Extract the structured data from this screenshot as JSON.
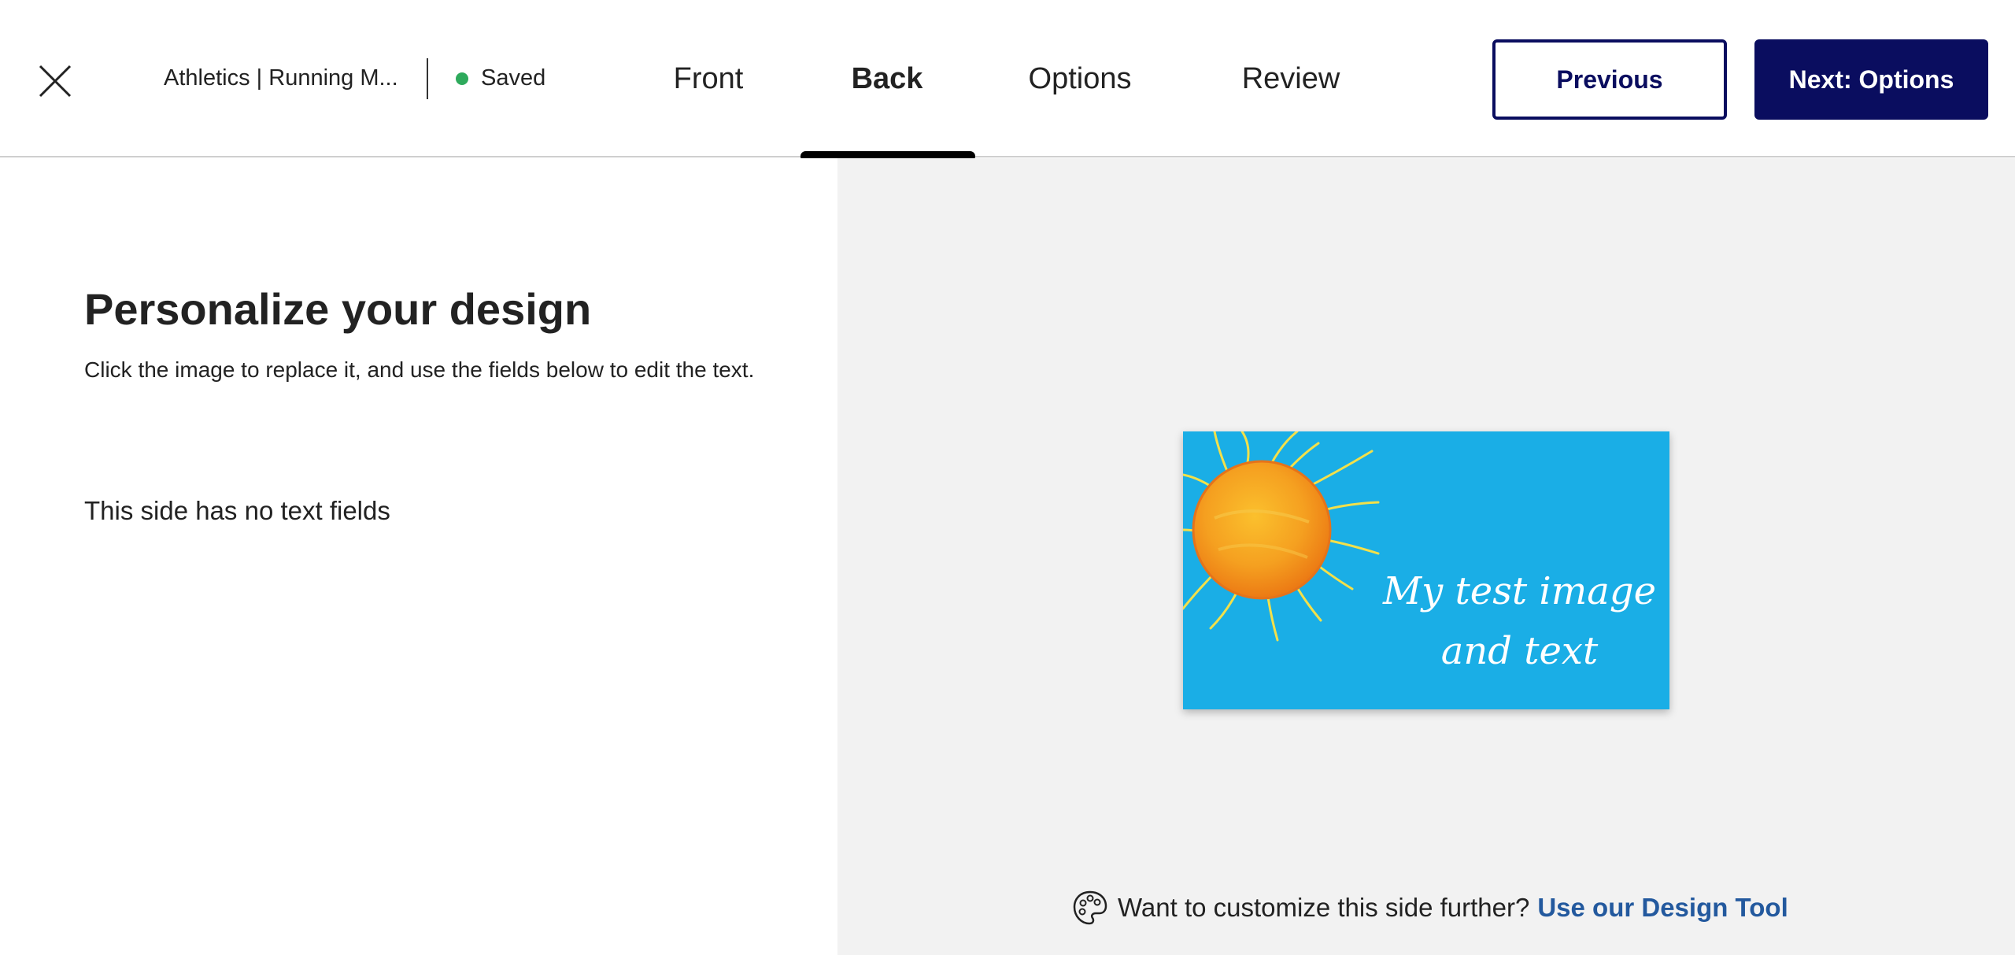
{
  "header": {
    "document_title": "Athletics | Running M...",
    "save_status": "Saved",
    "tabs": [
      {
        "label": "Front",
        "active": false
      },
      {
        "label": "Back",
        "active": true
      },
      {
        "label": "Options",
        "active": false
      },
      {
        "label": "Review",
        "active": false
      }
    ],
    "previous_label": "Previous",
    "next_label": "Next: Options"
  },
  "panel": {
    "title": "Personalize your design",
    "description": "Click the image to replace it, and use the fields below to edit the text.",
    "no_fields_note": "This side has no text fields"
  },
  "preview": {
    "card_text_line1": "My test image",
    "card_text_line2": "and text",
    "background_color": "#1aaee6"
  },
  "footer": {
    "prompt": "Want to customize this side further?",
    "link_label": "Use our Design Tool"
  },
  "colors": {
    "brand_navy": "#0a0d5f",
    "saved_green": "#2eaa5c",
    "link_blue": "#23599e"
  }
}
